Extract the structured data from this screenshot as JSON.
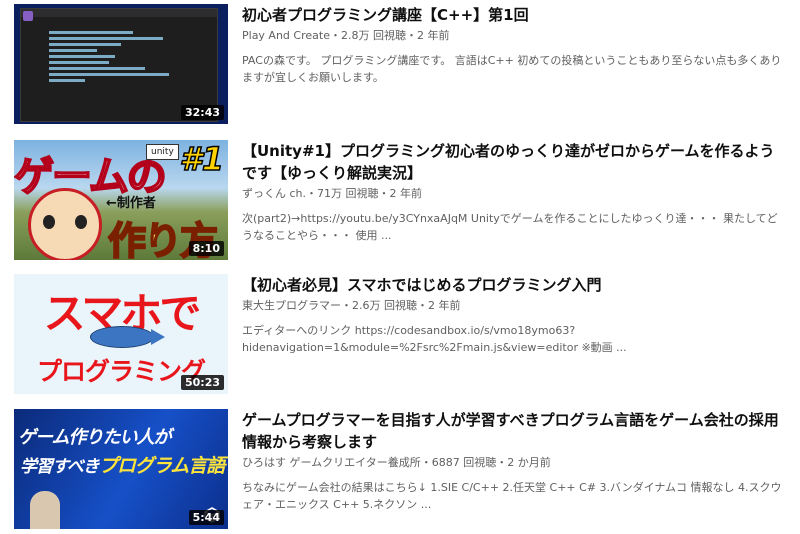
{
  "results": [
    {
      "title": "初心者プログラミング講座【C++】第1回",
      "channel": "Play And Create",
      "stats": "2.8万 回視聴・2 年前",
      "description": "PACの森です。 プログラミング講座です。 言語はC++ 初めての投稿ということもあり至らない点も多くありますが宜しくお願いします。",
      "duration": "32:43",
      "thumb_icon": "code-editor-thumbnail"
    },
    {
      "title": "【Unity#1】プログラミング初心者のゆっくり達がゼロからゲームを作るようです【ゆっくり解説実況】",
      "channel": "ずっくん ch.",
      "stats": "71万 回視聴・2 年前",
      "description": "次(part2)→https://youtu.be/y3CYnxaAJqM Unityでゲームを作ることにしたゆっくり達・・・ 果たしてどうなることやら・・・ 使用 ...",
      "duration": "8:10",
      "thumb_text": {
        "big": "ゲームの",
        "big2": "作り方",
        "num": "#1",
        "badge": "unity",
        "arrow_label": "←制作者"
      }
    },
    {
      "title": "【初心者必見】スマホではじめるプログラミング入門",
      "channel": "東大生プログラマー",
      "stats": "2.6万 回視聴・2 年前",
      "description": "エディターへのリンク https://codesandbox.io/s/vmo18ymo63?hidenavigation=1&module=%2Fsrc%2Fmain.js&view=editor ※動画 ...",
      "duration": "50:23",
      "thumb_text": {
        "line1": "スマホで",
        "line2": "プログラミング"
      }
    },
    {
      "title": "ゲームプログラマーを目指す人が学習すべきプログラム言語をゲーム会社の採用情報から考察します",
      "channel": "ひろはす ゲームクリエイター養成所",
      "stats": "6887 回視聴・2 か月前",
      "description": "ちなみにゲーム会社の結果はこちら↓ 1.SIE C/C++ 2.任天堂 C++ C# 3.バンダイナムコ 情報なし 4.スクウェア・エニックス C++ 5.ネクソン ...",
      "duration": "5:44",
      "thumb_text": {
        "line1": "ゲーム作りたい人が",
        "line2a": "学習すべき",
        "line2b": "プログラム言語"
      }
    }
  ],
  "meta_separator": "・"
}
